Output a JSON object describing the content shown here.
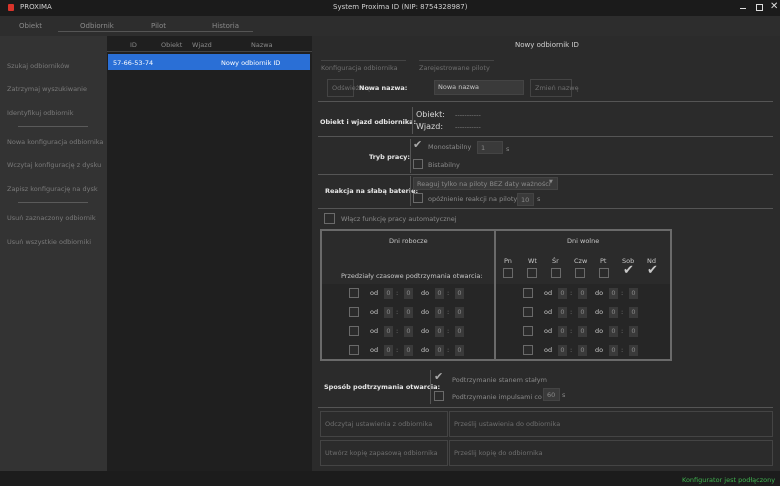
{
  "titlebar": {
    "app_name": "PROXIMA",
    "title": "System Proxima ID (NIP: 8754328987)",
    "logo_color": "#d9342b"
  },
  "top_tabs": [
    {
      "label": "Obiekt"
    },
    {
      "label": "Odbiornik"
    },
    {
      "label": "Pilot"
    },
    {
      "label": "Historia"
    }
  ],
  "sidebar": {
    "items": [
      {
        "label": "Szukaj odbiorników"
      },
      {
        "label": "Zatrzymaj wyszukiwanie"
      },
      {
        "label": "Identyfikuj odbiornik"
      },
      {
        "label": "Nowa konfiguracja odbiornika"
      },
      {
        "label": "Wczytaj konfigurację z dysku"
      },
      {
        "label": "Zapisz konfigurację na dysk"
      },
      {
        "label": "Usuń zaznaczony odbiornik"
      },
      {
        "label": "Usuń wszystkie odbiorniki"
      }
    ]
  },
  "table": {
    "headers": [
      "ID",
      "Obiekt",
      "Wjazd",
      "Nazwa"
    ],
    "rows": [
      {
        "id": "57-66-53-74",
        "obiekt": "",
        "wjazd": "",
        "nazwa": "Nowy odbiornik ID"
      }
    ],
    "selected_color": "#2a6fd6"
  },
  "right": {
    "header_title": "Nowy odbiornik ID",
    "subtabs": [
      "Konfiguracja odbiornika",
      "Zarejestrowane piloty"
    ],
    "odswiez_label": "Odśwież się",
    "nowa_nazwa_label": "Nowa nazwa:",
    "nowa_nazwa_value": "Nowa nazwa",
    "zmien_nazwe_label": "Zmień nazwę",
    "obiekt_wjazd_label": "Obiekt i wjazd odbiornika:",
    "obiekt_label": "Obiekt:",
    "obiekt_value": "-----------",
    "wjazd_label": "Wjazd:",
    "wjazd_value": "-----------",
    "tryb_label": "Tryb pracy:",
    "monostabilny_label": "Monostabilny",
    "monostabilny_value": "1",
    "unit_s": "s",
    "bistabilny_label": "Bistabilny",
    "reakcja_label": "Reakcja na słabą baterię:",
    "reakcja_select": "Reaguj tylko na piloty BEZ daty ważności",
    "opoznienie_label": "opóźnienie reakcji na piloty",
    "opoznienie_value": "10",
    "automat_label": "Włącz funkcję pracy automatycznej",
    "dni_robocze_label": "Dni robocze",
    "dni_wolne_label": "Dni wolne",
    "days": [
      "Pn",
      "Wt",
      "Śr",
      "Czw",
      "Pt",
      "Sob",
      "Nd"
    ],
    "przedzialy_label": "Przedziały czasowe podtrzymania otwarcia:",
    "od_label": "od",
    "do_label": "do",
    "time_colon": ":",
    "time_zero": "0",
    "sposob_label": "Sposób podtrzymania otwarcia:",
    "stan_label": "Podtrzymanie stanem stałym",
    "impuls_label": "Podtrzymanie impulsami co",
    "impuls_value": "60",
    "btn_odczytaj": "Odczytaj ustawienia z odbiornika",
    "btn_przeslij": "Prześlij ustawienia do odbiornika",
    "btn_kopia": "Utwórz kopię zapasową odbiornika",
    "btn_przywroc": "Prześlij kopię do odbiornika"
  },
  "status": {
    "text": "Konfigurator jest podłączony",
    "color": "#3fb34f"
  }
}
